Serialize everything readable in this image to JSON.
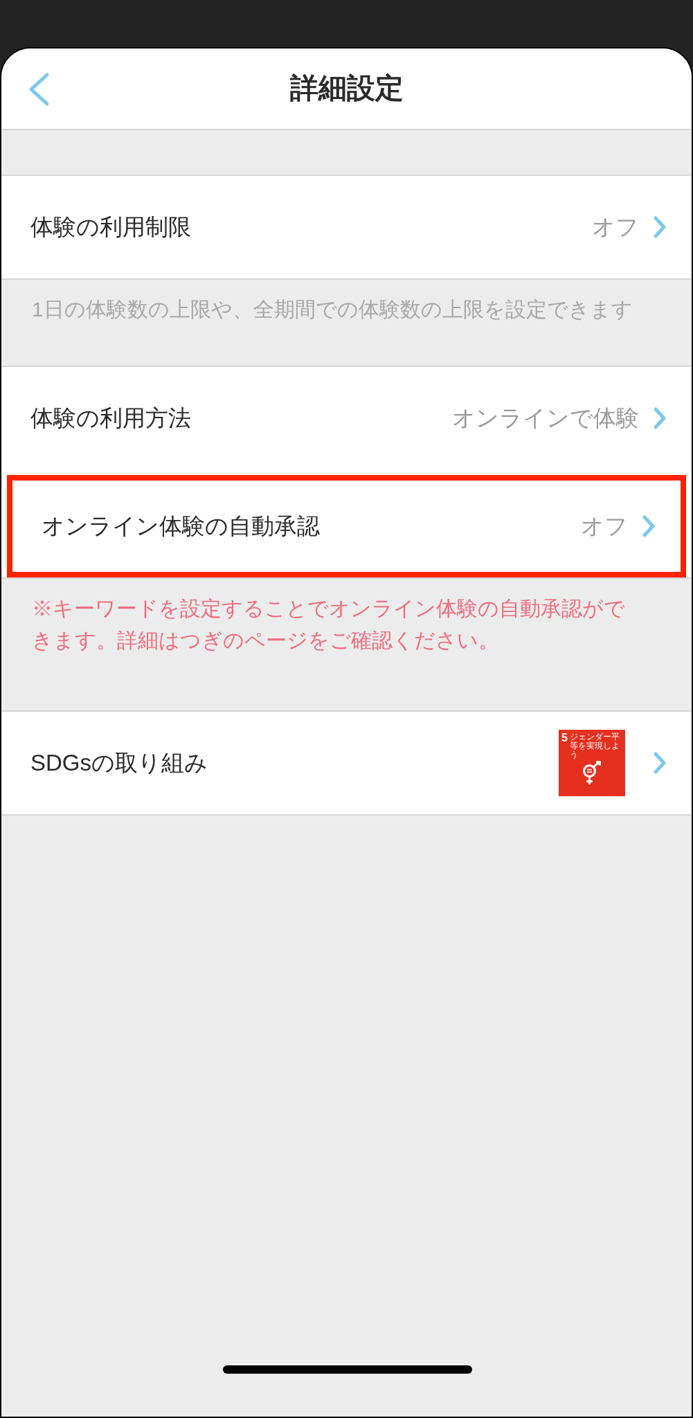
{
  "header": {
    "title": "詳細設定"
  },
  "sections": [
    {
      "rows": [
        {
          "label": "体験の利用制限",
          "value": "オフ",
          "highlighted": false
        }
      ],
      "note": {
        "text": "1日の体験数の上限や、全期間での体験数の上限を設定できます",
        "kind": "info"
      }
    },
    {
      "rows": [
        {
          "label": "体験の利用方法",
          "value": "オンラインで体験",
          "highlighted": false
        },
        {
          "label": "オンライン体験の自動承認",
          "value": "オフ",
          "highlighted": true
        }
      ],
      "note": {
        "text": "※キーワードを設定することでオンライン体験の自動承認ができます。詳細はつぎのページをご確認ください。",
        "kind": "warning"
      }
    },
    {
      "rows": [
        {
          "label": "SDGsの取り組み",
          "badge": {
            "number": "5",
            "caption": "ジェンダー平等を実現しよう"
          },
          "highlighted": false
        }
      ]
    }
  ]
}
